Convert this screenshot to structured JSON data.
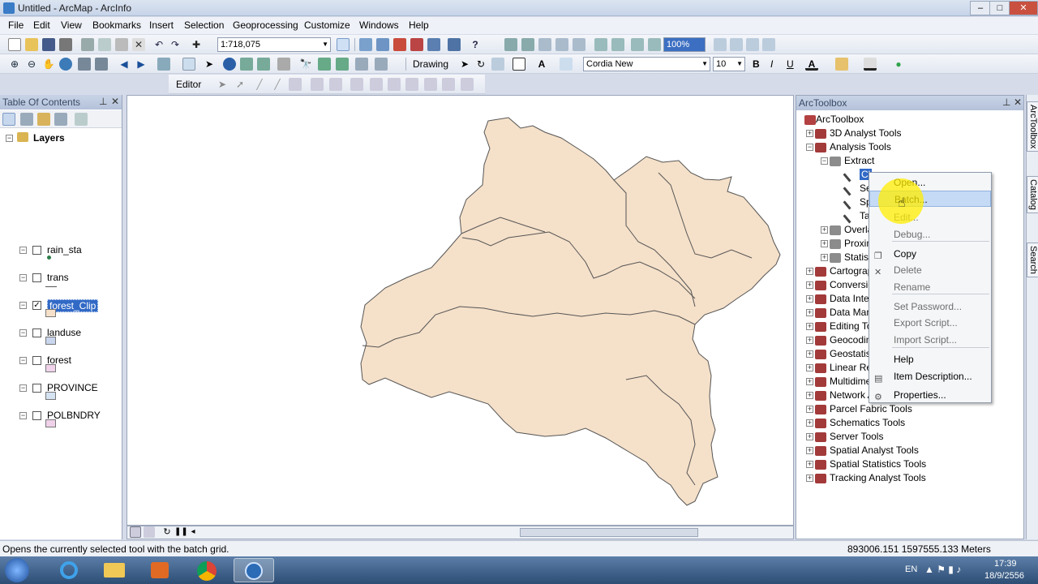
{
  "window": {
    "title": "Untitled - ArcMap - ArcInfo",
    "min": "–",
    "max": "□",
    "close": "✕"
  },
  "menu": [
    "File",
    "Edit",
    "View",
    "Bookmarks",
    "Insert",
    "Selection",
    "Geoprocessing",
    "Customize",
    "Windows",
    "Help"
  ],
  "toolbar": {
    "scale": "1:718,075",
    "zoom": "100%",
    "drawing_label": "Drawing",
    "font_name": "Cordia New",
    "font_size": "10",
    "bold": "B",
    "italic": "I",
    "underline": "U",
    "editor_label": "Editor"
  },
  "toc": {
    "title": "Table Of Contents",
    "root": "Layers",
    "layers": [
      {
        "name": "rain_sta",
        "checked": false,
        "swatch": "point",
        "color": "#2e7d4a"
      },
      {
        "name": "trans",
        "checked": false,
        "swatch": "line",
        "color": "#555555"
      },
      {
        "name": "forest_Clip",
        "checked": true,
        "swatch": "fill",
        "color": "#f5e0c9",
        "selected": true
      },
      {
        "name": "landuse",
        "checked": false,
        "swatch": "fill",
        "color": "#c9d6ee"
      },
      {
        "name": "forest",
        "checked": false,
        "swatch": "fill",
        "color": "#f1d4ec"
      },
      {
        "name": "PROVINCE",
        "checked": false,
        "swatch": "fill",
        "color": "#d5e3f3"
      },
      {
        "name": "POLBNDRY",
        "checked": false,
        "swatch": "fill",
        "color": "#efd2ea"
      }
    ]
  },
  "map": {
    "fill": "#f5e0c9",
    "stroke": "#555555"
  },
  "toolbox": {
    "title": "ArcToolbox",
    "root": "ArcToolbox",
    "items": [
      "3D Analyst Tools",
      "Analysis Tools",
      "Extract",
      "Cl",
      "Se",
      "Sp",
      "Ta",
      "Overlay",
      "Proximity",
      "Statistics",
      "Cartography Tools",
      "Conversion Tools",
      "Data Interoperability Tools",
      "Data Management Tools",
      "Editing Tools",
      "Geocoding Tools",
      "Geostatistical Analyst Tools",
      "Linear Referencing Tools",
      "Multidimension Tools",
      "Network Analyst Tools",
      "Parcel Fabric Tools",
      "Schematics Tools",
      "Server Tools",
      "Spatial Analyst Tools",
      "Spatial Statistics Tools",
      "Tracking Analyst Tools"
    ]
  },
  "side_tabs": [
    "ArcToolbox",
    "Catalog",
    "Search"
  ],
  "context_menu": {
    "items": [
      {
        "label": "Open...",
        "state": "normal"
      },
      {
        "label": "Batch...",
        "state": "highlight"
      },
      {
        "label": "Edit...",
        "state": "disabled"
      },
      {
        "label": "Debug...",
        "state": "disabled"
      },
      {
        "label": "Copy",
        "state": "normal"
      },
      {
        "label": "Delete",
        "state": "disabled"
      },
      {
        "label": "Rename",
        "state": "disabled"
      },
      {
        "label": "Set Password...",
        "state": "disabled"
      },
      {
        "label": "Export Script...",
        "state": "disabled"
      },
      {
        "label": "Import Script...",
        "state": "disabled"
      },
      {
        "label": "Help",
        "state": "normal"
      },
      {
        "label": "Item Description...",
        "state": "normal"
      },
      {
        "label": "Properties...",
        "state": "normal"
      }
    ]
  },
  "status": {
    "message": "Opens the currently selected tool with the batch grid.",
    "coords": "893006.151  1597555.133 Meters"
  },
  "taskbar": {
    "lang": "EN",
    "time": "17:39",
    "date": "18/9/2556"
  }
}
